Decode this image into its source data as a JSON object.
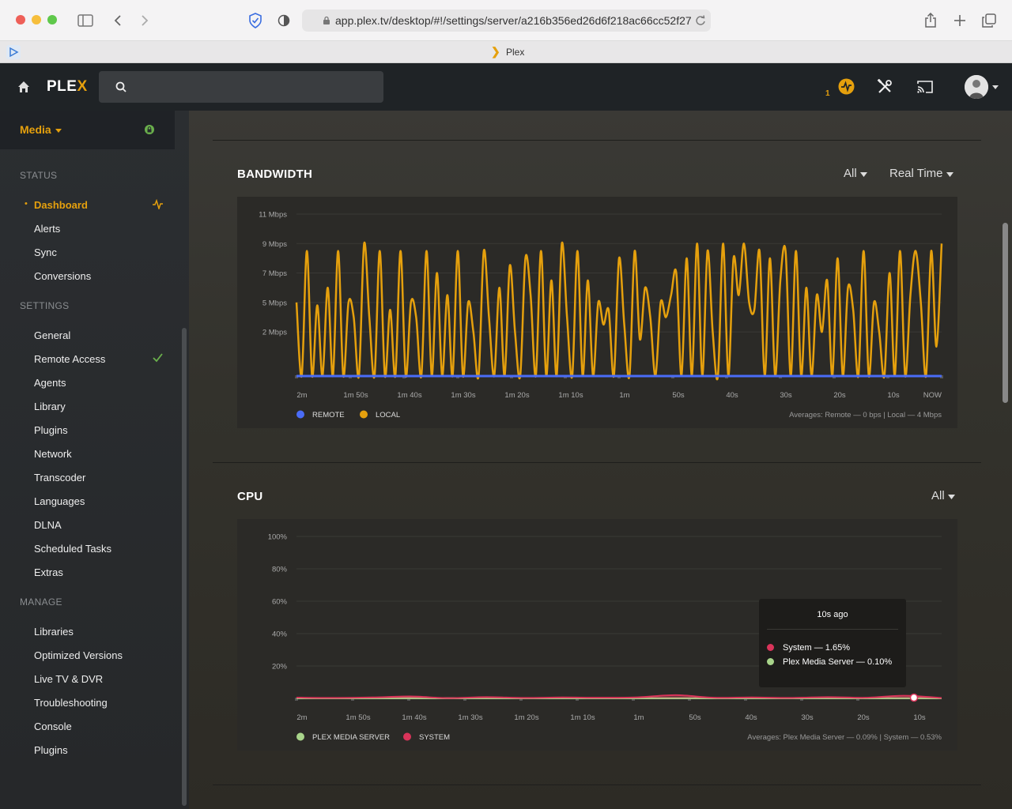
{
  "browser": {
    "url": "app.plex.tv/desktop/#!/settings/server/a216b356ed26d6f218ac66cc52f27",
    "tab_title": "Plex"
  },
  "app": {
    "logo_main": "PLE",
    "logo_x": "X",
    "activity_count": "1"
  },
  "sidebar": {
    "media_label": "Media",
    "sections": {
      "status": "STATUS",
      "settings": "SETTINGS",
      "manage": "MANAGE"
    },
    "status_items": [
      "Dashboard",
      "Alerts",
      "Sync",
      "Conversions"
    ],
    "settings_items": [
      "General",
      "Remote Access",
      "Agents",
      "Library",
      "Plugins",
      "Network",
      "Transcoder",
      "Languages",
      "DLNA",
      "Scheduled Tasks",
      "Extras"
    ],
    "manage_items": [
      "Libraries",
      "Optimized Versions",
      "Live TV & DVR",
      "Troubleshooting",
      "Console",
      "Plugins"
    ]
  },
  "bandwidth": {
    "title": "BANDWIDTH",
    "filter": "All",
    "range": "Real Time",
    "legend": [
      "REMOTE",
      "LOCAL"
    ],
    "averages": "Averages: Remote — 0 bps | Local — 4 Mbps"
  },
  "cpu": {
    "title": "CPU",
    "filter": "All",
    "legend": [
      "PLEX MEDIA SERVER",
      "SYSTEM"
    ],
    "averages": "Averages: Plex Media Server — 0.09% | System — 0.53%",
    "tooltip": {
      "title": "10s ago",
      "rows": [
        "System — 1.65%",
        "Plex Media Server — 0.10%"
      ]
    }
  },
  "colors": {
    "accent": "#e5a00d",
    "remote": "#4a6cf7",
    "local": "#e5a00d",
    "system": "#d9345a",
    "pms": "#a8d48a"
  },
  "chart_data": [
    {
      "type": "line",
      "title": "BANDWIDTH",
      "x_ticks": [
        "2m",
        "1m 50s",
        "1m 40s",
        "1m 30s",
        "1m 20s",
        "1m 10s",
        "1m",
        "50s",
        "40s",
        "30s",
        "20s",
        "10s",
        "NOW"
      ],
      "y_ticks": [
        "11 Mbps",
        "9 Mbps",
        "7 Mbps",
        "5 Mbps",
        "2 Mbps"
      ],
      "ylim": [
        0,
        11
      ],
      "series": [
        {
          "name": "REMOTE",
          "values": [
            0,
            0,
            0,
            0,
            0,
            0,
            0,
            0,
            0,
            0,
            0,
            0,
            0
          ]
        },
        {
          "name": "LOCAL",
          "values": [
            5,
            0,
            8.5,
            0,
            4.8,
            0,
            6,
            0,
            8.5,
            0,
            5,
            4,
            0,
            9,
            4,
            0,
            8.5,
            0,
            4.5,
            0,
            8.5,
            0,
            5,
            4,
            0,
            8.5,
            0,
            7,
            0,
            5.5,
            0,
            8.5,
            0,
            5,
            3,
            0,
            8.5,
            4,
            0,
            6,
            0,
            7.5,
            3,
            0,
            8,
            5.5,
            0,
            8.5,
            0,
            6.5,
            0,
            9,
            4,
            0,
            8.5,
            0,
            6.5,
            0,
            5,
            3.5,
            4.5,
            0,
            8,
            3.5,
            0,
            8.5,
            2.5,
            6,
            4,
            0,
            5,
            4,
            5.5,
            7,
            0,
            8,
            0,
            9,
            0,
            8.5,
            3,
            0,
            9,
            0,
            8,
            5.5,
            9,
            5,
            4.5,
            8.5,
            0,
            8,
            0,
            6.5,
            8.5,
            0,
            8.5,
            0,
            6,
            0,
            5.5,
            3,
            6.5,
            0,
            8,
            0,
            6,
            4.5,
            0,
            8.5,
            0,
            5,
            3,
            0,
            7,
            0,
            8.5,
            0,
            5.5,
            8.5,
            5,
            0,
            8.5,
            2,
            9
          ]
        }
      ]
    },
    {
      "type": "line",
      "title": "CPU",
      "x_ticks": [
        "2m",
        "1m 50s",
        "1m 40s",
        "1m 30s",
        "1m 20s",
        "1m 10s",
        "1m",
        "50s",
        "40s",
        "30s",
        "20s",
        "10s"
      ],
      "y_ticks": [
        "100%",
        "80%",
        "60%",
        "40%",
        "20%"
      ],
      "ylim": [
        0,
        100
      ],
      "series": [
        {
          "name": "PLEX MEDIA SERVER",
          "values": [
            0.1,
            0.1,
            0.1,
            0.1,
            0.1,
            0.1,
            0.1,
            0.1,
            0.1,
            0.1,
            0.1,
            0.1,
            0.1
          ]
        },
        {
          "name": "SYSTEM",
          "values": [
            0.5,
            0.3,
            0.6,
            1.2,
            0.2,
            0.8,
            0.3,
            0.6,
            0.4,
            0.7,
            2.0,
            0.4,
            0.6,
            0.3,
            0.8,
            0.4,
            1.65,
            0.3
          ]
        }
      ]
    }
  ]
}
